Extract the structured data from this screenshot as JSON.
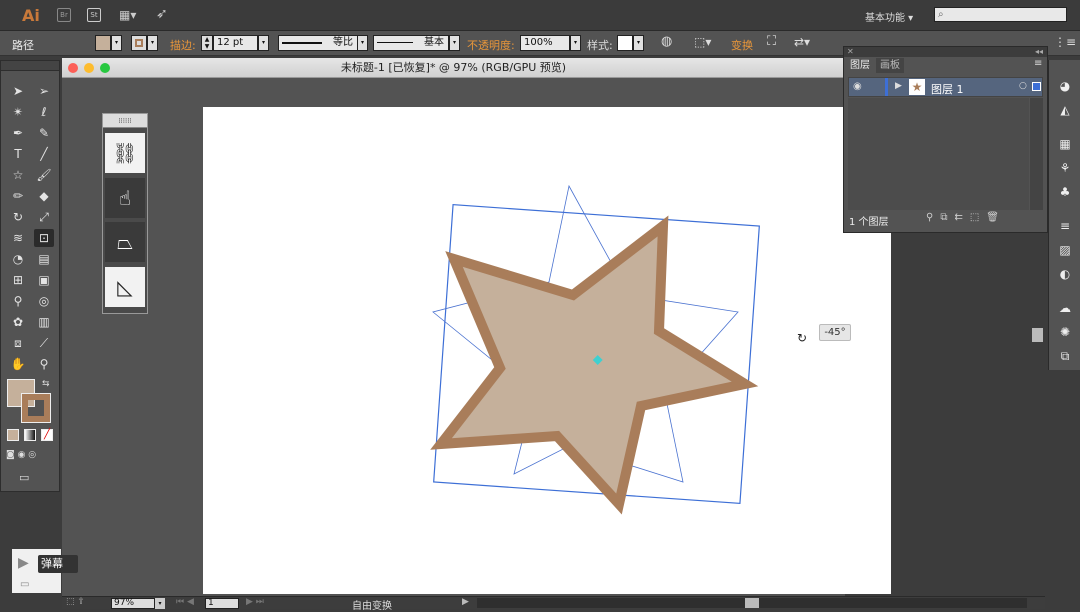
{
  "app": {
    "logo": "Ai",
    "br_label": "Br",
    "st_label": "St",
    "workspace": "基本功能 ▾"
  },
  "control": {
    "path_label": "路径",
    "stroke_label": "描边:",
    "stroke_value": "12 pt",
    "profile_label": "等比",
    "brush_label": "基本",
    "opacity_label": "不透明度:",
    "opacity_value": "100%",
    "style_label": "样式:",
    "transform_label": "变换",
    "arrows": "▾"
  },
  "document": {
    "title": "未标题-1 [已恢复]* @ 97% (RGB/GPU 预览)"
  },
  "canvas": {
    "angle_tooltip": "-45°",
    "fill_color": "#c5b09b",
    "stroke_color": "#a97d5a",
    "selection_color": "#3d6fd6"
  },
  "layers_panel": {
    "tab_layers": "图层",
    "tab_artboards": "画板",
    "layer_name": "图层 1",
    "count_label": "1 个图层"
  },
  "status": {
    "zoom": "97%",
    "page": "1",
    "mode": "自由变换"
  },
  "overlay": {
    "danmu": "弹幕"
  }
}
